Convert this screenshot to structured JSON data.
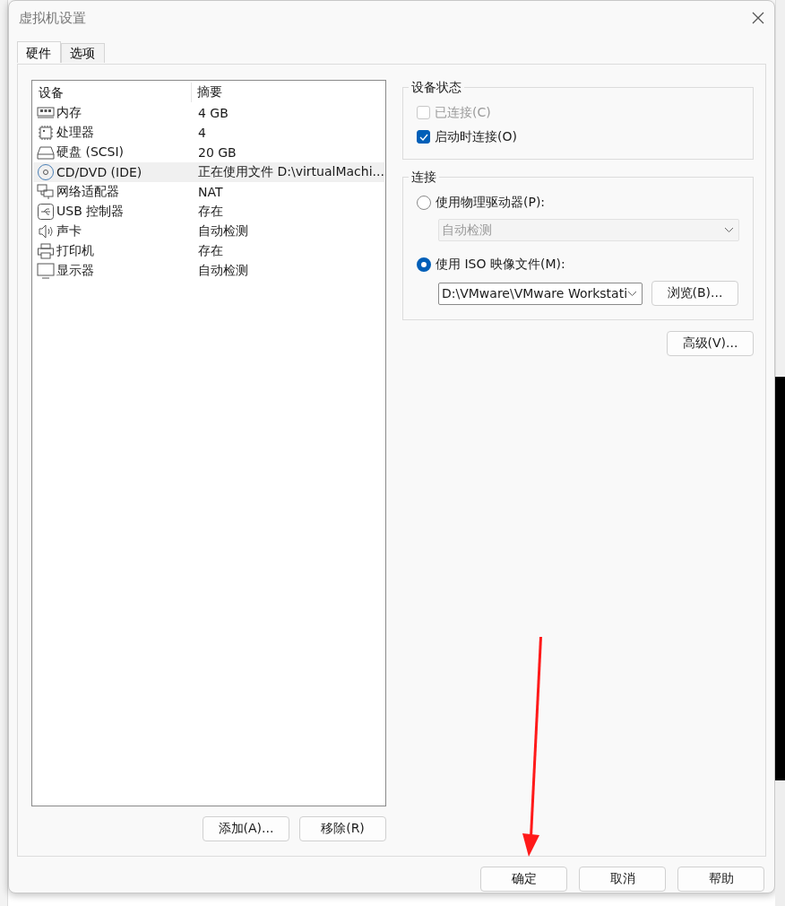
{
  "window": {
    "title": "虚拟机设置"
  },
  "tabs": [
    {
      "label": "硬件",
      "selected": true
    },
    {
      "label": "选项",
      "selected": false
    }
  ],
  "devices": {
    "columns": [
      "设备",
      "摘要"
    ],
    "rows": [
      {
        "kind": "memory",
        "name": "内存",
        "summary": "4 GB",
        "selected": false
      },
      {
        "kind": "processor",
        "name": "处理器",
        "summary": "4",
        "selected": false
      },
      {
        "kind": "disk",
        "name": "硬盘 (SCSI)",
        "summary": "20 GB",
        "selected": false
      },
      {
        "kind": "optical",
        "name": "CD/DVD (IDE)",
        "summary": "正在使用文件 D:\\virtualMachi...",
        "selected": true
      },
      {
        "kind": "network",
        "name": "网络适配器",
        "summary": "NAT",
        "selected": false
      },
      {
        "kind": "usb",
        "name": "USB 控制器",
        "summary": "存在",
        "selected": false
      },
      {
        "kind": "sound",
        "name": "声卡",
        "summary": "自动检测",
        "selected": false
      },
      {
        "kind": "printer",
        "name": "打印机",
        "summary": "存在",
        "selected": false
      },
      {
        "kind": "display",
        "name": "显示器",
        "summary": "自动检测",
        "selected": false
      }
    ]
  },
  "list_buttons": [
    "添加(A)...",
    "移除(R)"
  ],
  "device_status": {
    "title": "设备状态",
    "options": [
      {
        "label": "已连接(C)",
        "checked": false,
        "disabled": true
      },
      {
        "label": "启动时连接(O)",
        "checked": true,
        "disabled": false
      }
    ]
  },
  "connection": {
    "title": "连接",
    "options": [
      {
        "label": "使用物理驱动器(P):",
        "selected": false,
        "dropdown": {
          "value": "自动检测",
          "disabled": true
        }
      },
      {
        "label": "使用 ISO 映像文件(M):",
        "selected": true,
        "dropdown": {
          "value": "D:\\VMware\\VMware Workstati",
          "disabled": false
        },
        "button": "浏览(B)..."
      }
    ]
  },
  "advanced_button": "高级(V)...",
  "dialog_buttons": [
    "确定",
    "取消",
    "帮助"
  ]
}
